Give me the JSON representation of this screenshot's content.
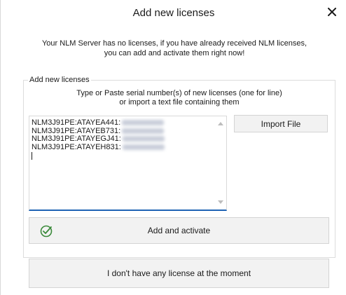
{
  "dialog": {
    "title": "Add new licenses",
    "close_icon": "close-icon",
    "intro_line1": "Your NLM Server has no licenses, if you have already received NLM licenses,",
    "intro_line2": "you can add and activate them right now!"
  },
  "group": {
    "legend": "Add new licenses",
    "instructions_line1": "Type or Paste serial number(s) of new licenses (one for line)",
    "instructions_line2": "or import a text file containing them",
    "serials": [
      "NLM3J91PE:ATAYEA441:",
      "NLM3J91PE:ATAYEB731:",
      "NLM3J91PE:ATAYEGJ41:",
      "NLM3J91PE:ATAYEH831:"
    ],
    "import_label": "Import File",
    "activate_label": "Add and activate",
    "activate_icon": "check-circle-icon"
  },
  "footer": {
    "no_license_label": "I don't have any license at the moment"
  },
  "colors": {
    "accent": "#1e63b4",
    "check": "#3a8a3a",
    "button_bg": "#f2f2f2"
  }
}
